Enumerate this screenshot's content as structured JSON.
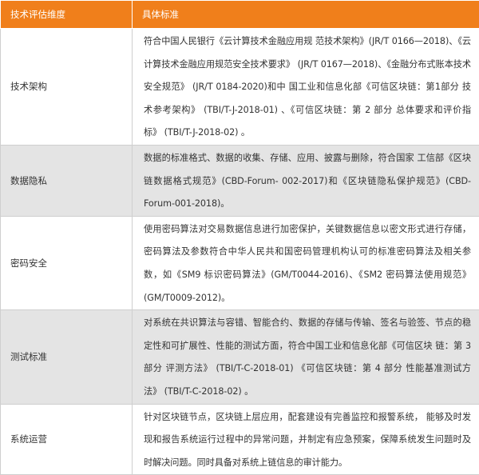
{
  "header": {
    "col1": "技术评估维度",
    "col2": "具体标准"
  },
  "rows": [
    {
      "dimension": "技术架构",
      "standard": "符合中国人民银行《云计算技术金融应用规 范技术架构》(JR/T 0166—2018)、《云计算技术金融应用规范安全技术要求》 (JR/T 0167—2018)、《金融分布式账本技术安全规范》 (JR/T 0184-2020)和中 国工业和信息化部《可信区块链：第1部分 技术参考架构》 (TBI/T-J-2018-01) 、《可信区块链：第 2 部分 总体要求和评价指标》 (TBI/T-J-2018-02) 。"
    },
    {
      "dimension": "数据隐私",
      "standard": "数据的标准格式、数据的收集、存储、应用、披露与删除，符合国家 工信部《区块链数据格式规范》(CBD-Forum- 002-2017)和《区块链隐私保护规范》(CBD-Forum-001-2018)。"
    },
    {
      "dimension": "密码安全",
      "standard": "使用密码算法对交易数据信息进行加密保护，关键数据信息以密文形式进行存储，密码算法及参数符合中华人民共和国密码管理机构认可的标准密码算法及相关参数，如《SM9 标识密码算法》(GM/T0044-2016)、《SM2 密码算法使用规范》(GM/T0009-2012)。"
    },
    {
      "dimension": "测试标准",
      "standard": "对系统在共识算法与容错、智能合约、数据的存储与传输、签名与验签、节点的稳定性和可扩展性、性能的测试方面，符合中国工业和信息化部《可信区块 链：第 3 部分 评测方法》 (TBI/T-C-2018-01) 《可信区块链：第 4 部分 性能基准测试方法》 (TBI/T-C-2018-02) 。"
    },
    {
      "dimension": "系统运营",
      "standard": "针对区块链节点，区块链上层应用，配套建设有完善监控和报警系统， 能够及时发现和报告系统运行过程中的异常问题，并制定有应急预案，保障系统发生问题时及时解决问题。同时具备对系统上链信息的审计能力。"
    }
  ]
}
